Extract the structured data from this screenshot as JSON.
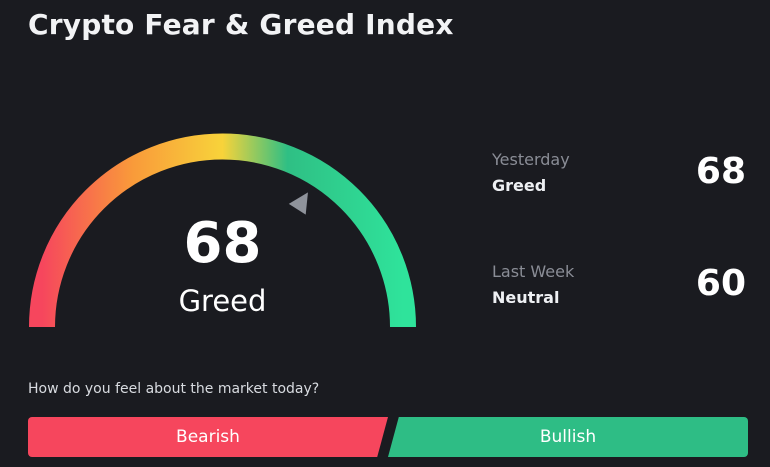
{
  "title": "Crypto Fear & Greed Index",
  "gauge": {
    "value": "68",
    "label": "Greed",
    "level": 68,
    "colors": [
      "#f6465d",
      "#f99a3a",
      "#f8d33a",
      "#2fbf84",
      "#2fe39b"
    ],
    "indicator_color": "#8f939b"
  },
  "history": [
    {
      "period": "Yesterday",
      "sentiment": "Greed",
      "value": "68"
    },
    {
      "period": "Last Week",
      "sentiment": "Neutral",
      "value": "60"
    }
  ],
  "poll": {
    "question": "How do you feel about the market today?",
    "bearish_label": "Bearish",
    "bullish_label": "Bullish",
    "bearish_color": "#f6465d",
    "bullish_color": "#2ebd85"
  }
}
